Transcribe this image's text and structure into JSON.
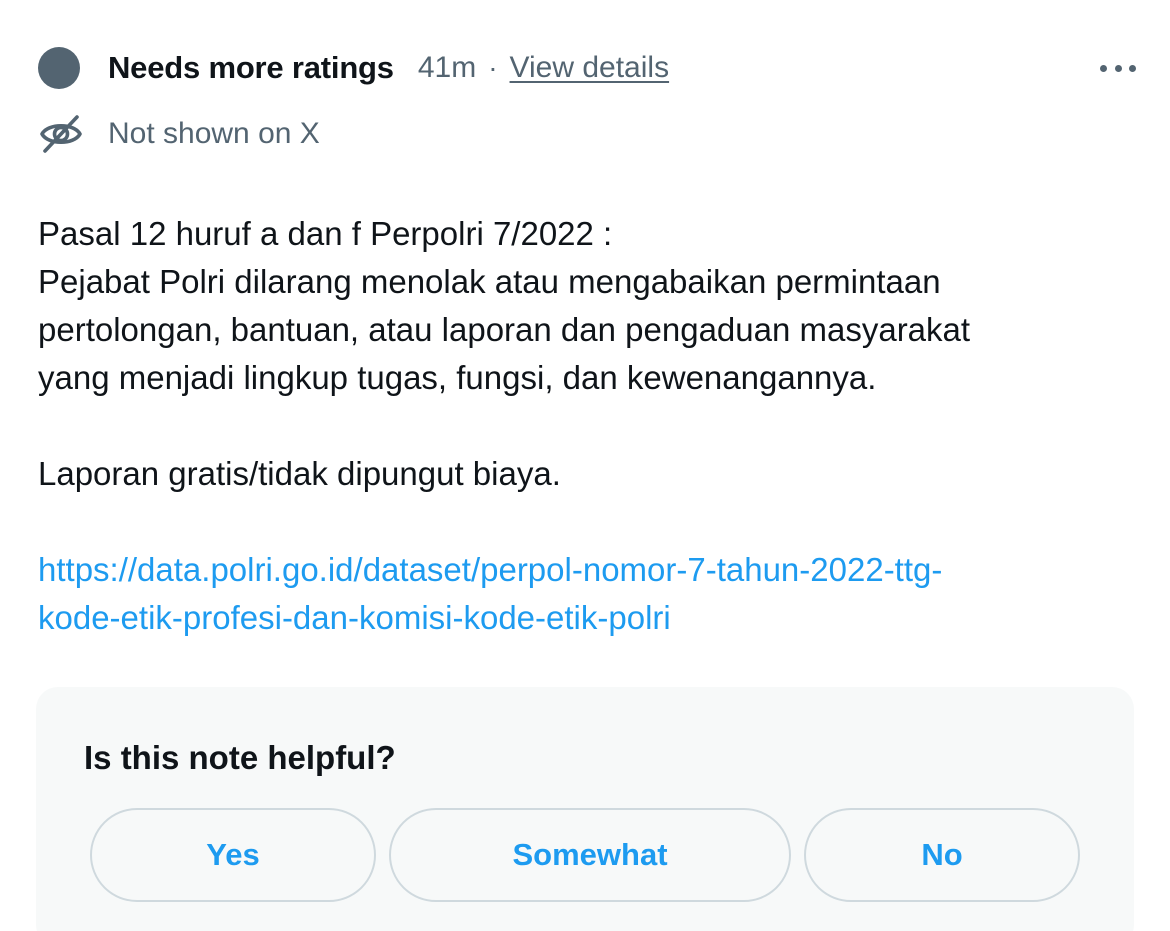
{
  "header": {
    "status_title": "Needs more ratings",
    "time": "41m",
    "separator": "·",
    "details_link": "View details",
    "more_icon": "more-horizontal-icon"
  },
  "visibility": {
    "icon": "eye-slash-icon",
    "text": "Not shown on X"
  },
  "note": {
    "lines": [
      "Pasal 12 huruf a dan f Perpolri 7/2022 :",
      "Pejabat Polri dilarang menolak atau mengabaikan permintaan",
      "pertolongan, bantuan, atau laporan dan pengaduan masyarakat",
      "yang menjadi lingkup tugas, fungsi, dan kewenangannya."
    ],
    "second_paragraph": "Laporan gratis/tidak dipungut biaya.",
    "link_lines": [
      "https://data.polri.go.id/dataset/perpol-nomor-7-tahun-2022-ttg-",
      "kode-etik-profesi-dan-komisi-kode-etik-polri"
    ]
  },
  "rating": {
    "question": "Is this note helpful?",
    "buttons": [
      "Yes",
      "Somewhat",
      "No"
    ]
  },
  "colors": {
    "text": "#0f1419",
    "secondary": "#536471",
    "accent": "#1d9bf0",
    "card_bg": "#f7f9f9",
    "border": "#cfd9de"
  }
}
